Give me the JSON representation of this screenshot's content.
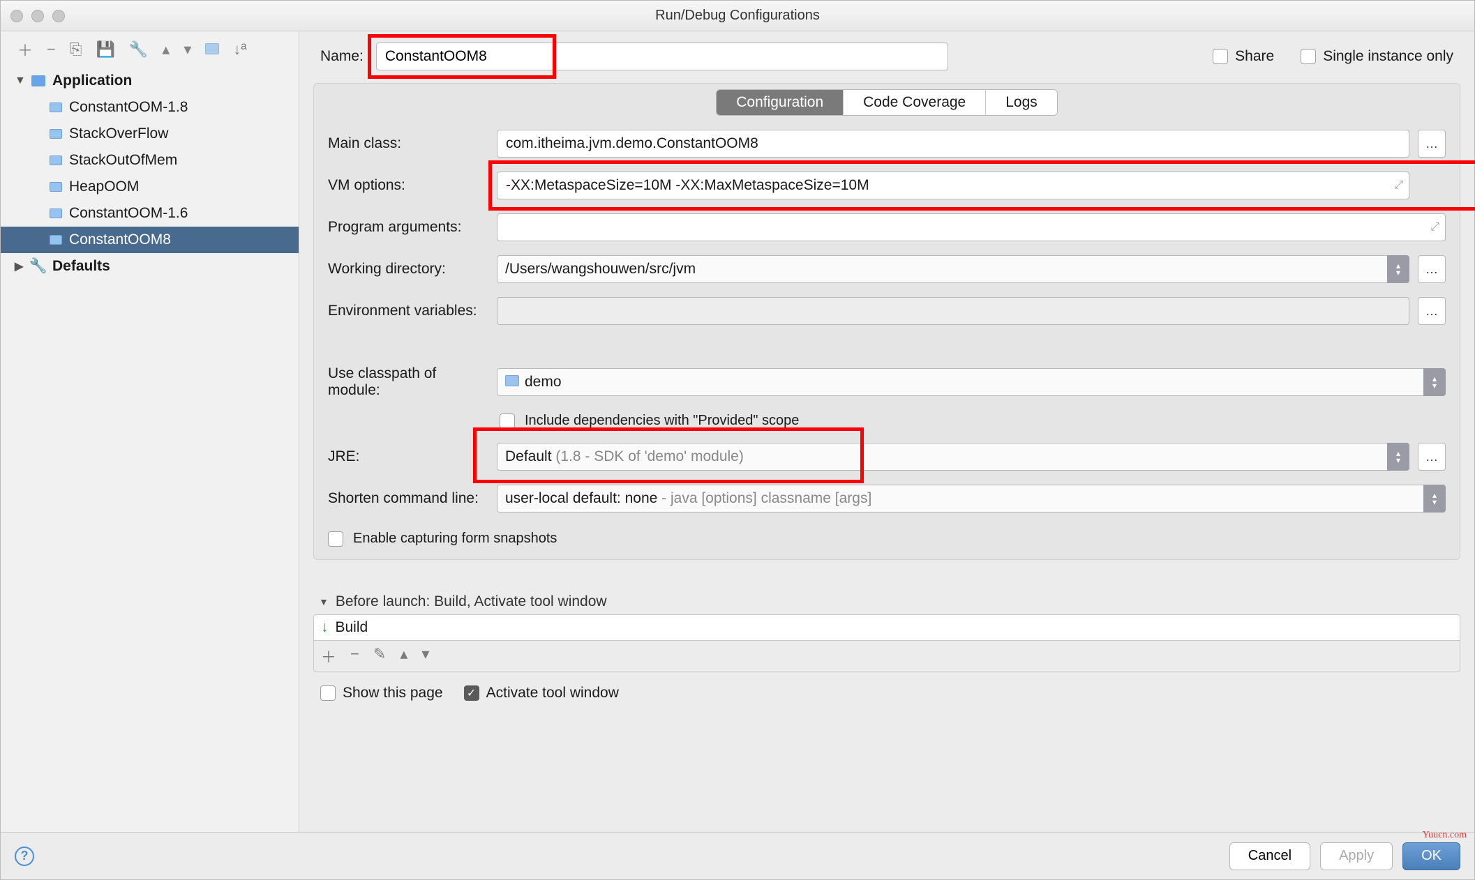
{
  "window": {
    "title": "Run/Debug Configurations"
  },
  "name_field": {
    "label": "Name:",
    "value": "ConstantOOM8"
  },
  "checkboxes": {
    "share": "Share",
    "single_instance": "Single instance only"
  },
  "sidebar": {
    "root": "Application",
    "items": [
      {
        "label": "ConstantOOM-1.8"
      },
      {
        "label": "StackOverFlow"
      },
      {
        "label": "StackOutOfMem"
      },
      {
        "label": "HeapOOM"
      },
      {
        "label": "ConstantOOM-1.6"
      },
      {
        "label": "ConstantOOM8",
        "selected": true
      }
    ],
    "defaults": "Defaults"
  },
  "tabs": {
    "configuration": "Configuration",
    "code_coverage": "Code Coverage",
    "logs": "Logs"
  },
  "form": {
    "main_class": {
      "label": "Main class:",
      "value": "com.itheima.jvm.demo.ConstantOOM8"
    },
    "vm_options": {
      "label": "VM options:",
      "value": "-XX:MetaspaceSize=10M -XX:MaxMetaspaceSize=10M"
    },
    "program_args": {
      "label": "Program arguments:",
      "value": ""
    },
    "working_dir": {
      "label": "Working directory:",
      "value": "/Users/wangshouwen/src/jvm"
    },
    "env_vars": {
      "label": "Environment variables:",
      "value": ""
    },
    "classpath_module": {
      "label": "Use classpath of module:",
      "value": "demo"
    },
    "include_provided": "Include dependencies with \"Provided\" scope",
    "jre": {
      "label": "JRE:",
      "value": "Default",
      "hint": "(1.8 - SDK of 'demo' module)"
    },
    "shorten": {
      "label": "Shorten command line:",
      "value": "user-local default: none",
      "hint": "- java [options] classname [args]"
    },
    "enable_snapshots": "Enable capturing form snapshots"
  },
  "before_launch": {
    "header": "Before launch: Build, Activate tool window",
    "item": "Build",
    "show_page": "Show this page",
    "activate": "Activate tool window"
  },
  "footer": {
    "cancel": "Cancel",
    "apply": "Apply",
    "ok": "OK"
  },
  "watermark": "Yuucn.com"
}
